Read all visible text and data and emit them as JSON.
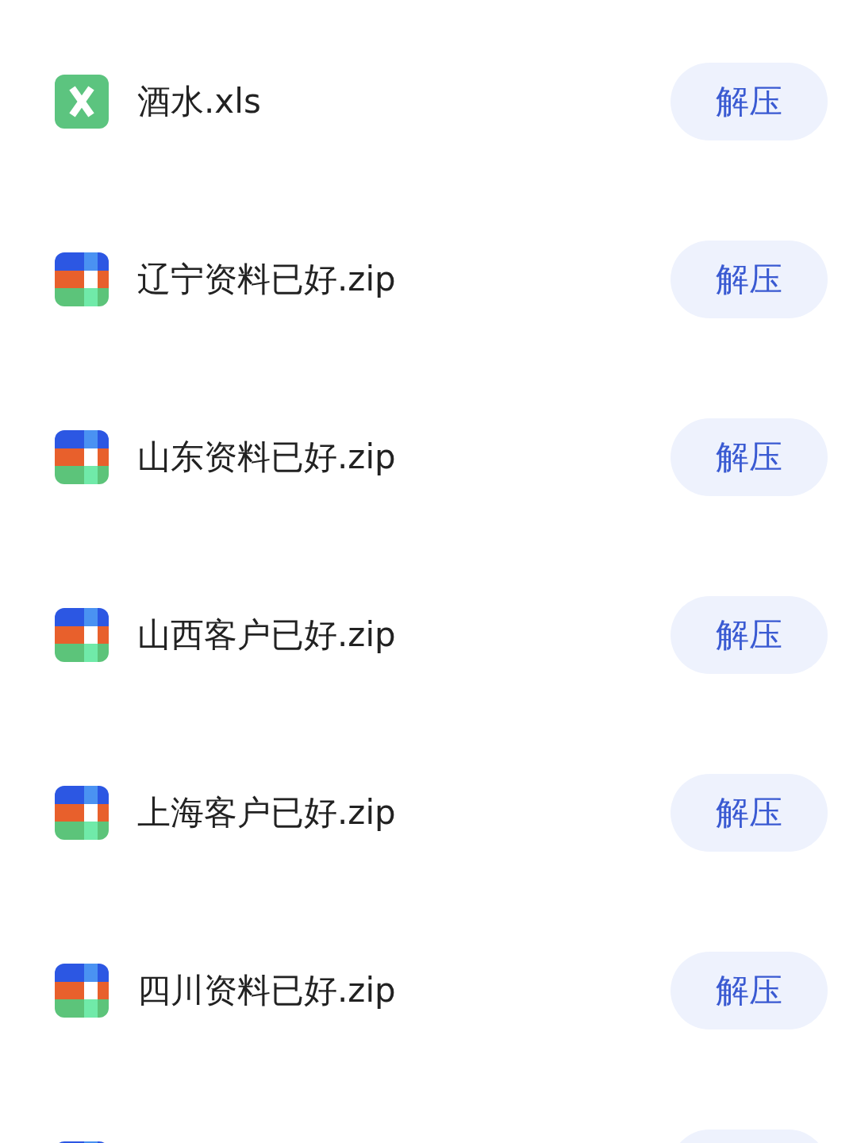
{
  "files": [
    {
      "kind": "xls",
      "name": "酒水.xls",
      "action": "解压"
    },
    {
      "kind": "zip",
      "name": "辽宁资料已好.zip",
      "action": "解压"
    },
    {
      "kind": "zip",
      "name": "山东资料已好.zip",
      "action": "解压"
    },
    {
      "kind": "zip",
      "name": "山西客户已好.zip",
      "action": "解压"
    },
    {
      "kind": "zip",
      "name": "上海客户已好.zip",
      "action": "解压"
    },
    {
      "kind": "zip",
      "name": "四川资料已好.zip",
      "action": "解压"
    },
    {
      "kind": "zip"
    }
  ]
}
